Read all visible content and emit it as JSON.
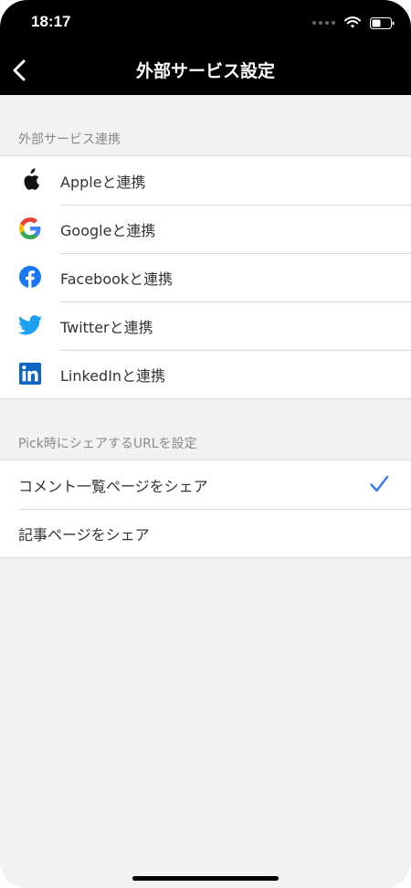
{
  "status_bar": {
    "time": "18:17"
  },
  "nav": {
    "title": "外部サービス設定"
  },
  "services_section": {
    "header": "外部サービス連携",
    "items": [
      {
        "label": "Appleと連携",
        "icon": "apple-icon"
      },
      {
        "label": "Googleと連携",
        "icon": "google-icon"
      },
      {
        "label": "Facebookと連携",
        "icon": "facebook-icon"
      },
      {
        "label": "Twitterと連携",
        "icon": "twitter-icon"
      },
      {
        "label": "LinkedInと連携",
        "icon": "linkedin-icon"
      }
    ]
  },
  "share_section": {
    "header": "Pick時にシェアするURLを設定",
    "options": [
      {
        "label": "コメント一覧ページをシェア",
        "selected": true
      },
      {
        "label": "記事ページをシェア",
        "selected": false
      }
    ]
  },
  "colors": {
    "accent": "#3478f6",
    "facebook": "#1877f2",
    "twitter": "#1da1f2",
    "linkedin": "#0a66c2"
  }
}
